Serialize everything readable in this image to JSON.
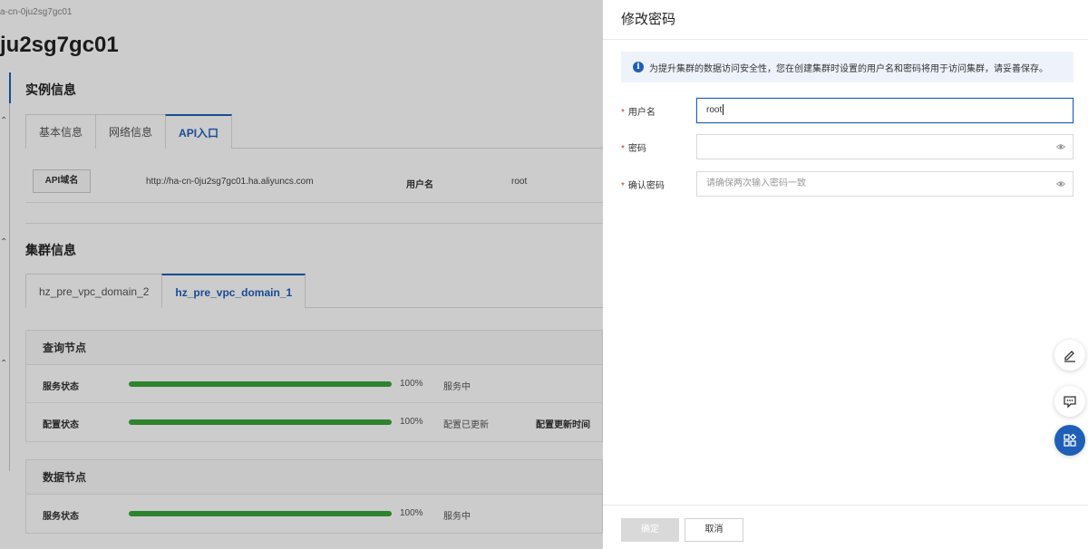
{
  "background": {
    "breadcrumb": "a-cn-0ju2sg7gc01",
    "title": "ju2sg7gc01",
    "instance_section": {
      "title": "实例信息",
      "tabs": [
        {
          "label": "基本信息",
          "active": false
        },
        {
          "label": "网络信息",
          "active": false
        },
        {
          "label": "API入口",
          "active": true
        }
      ],
      "api": {
        "key_label": "API域名",
        "url": "http://ha-cn-0ju2sg7gc01.ha.aliyuncs.com",
        "user_label": "用户名",
        "user_value": "root"
      }
    },
    "cluster_section": {
      "title": "集群信息",
      "tabs": [
        {
          "label": "hz_pre_vpc_domain_2",
          "active": false
        },
        {
          "label": "hz_pre_vpc_domain_1",
          "active": true
        }
      ],
      "query_nodes": {
        "title": "查询节点",
        "rows": [
          {
            "label": "服务状态",
            "progress": 100,
            "pct": "100%",
            "status": "服务中",
            "extra": ""
          },
          {
            "label": "配置状态",
            "progress": 100,
            "pct": "100%",
            "status": "配置已更新",
            "extra": "配置更新时间"
          }
        ]
      },
      "data_nodes": {
        "title": "数据节点",
        "rows": [
          {
            "label": "服务状态",
            "progress": 100,
            "pct": "100%",
            "status": "服务中",
            "extra": ""
          }
        ]
      }
    }
  },
  "drawer": {
    "title": "修改密码",
    "notice": "为提升集群的数据访问安全性，您在创建集群时设置的用户名和密码将用于访问集群，请妥善保存。",
    "form": {
      "username_label": "用户名",
      "username_value": "root",
      "password_label": "密码",
      "password_value": "",
      "confirm_label": "确认密码",
      "confirm_placeholder": "请确保两次输入密码一致"
    },
    "ok_label": "确定",
    "cancel_label": "取消"
  },
  "floating_buttons": [
    "edit-icon",
    "feedback-icon",
    "apps-icon"
  ],
  "colors": {
    "primary": "#1f5fb8",
    "progress": "#3aa53a",
    "required": "#d0342c",
    "notice_bg": "#eef3fb"
  }
}
